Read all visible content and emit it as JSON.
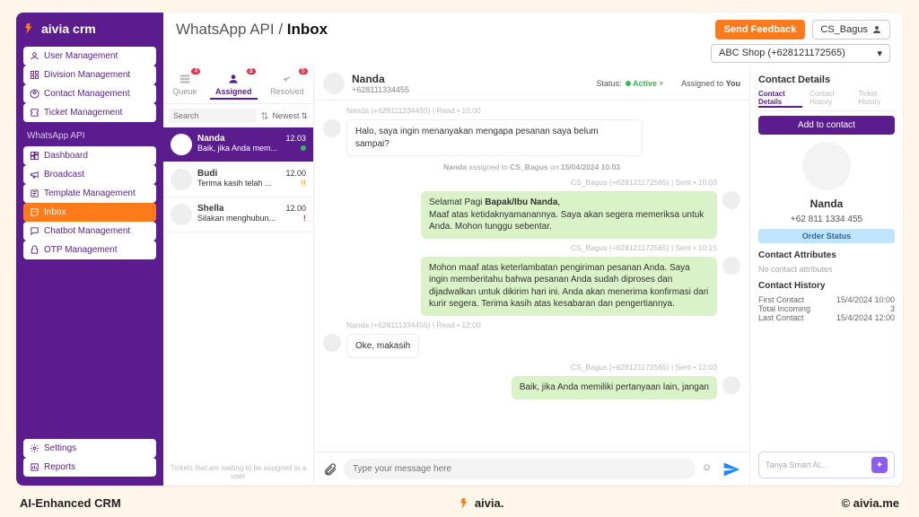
{
  "brand": "aivia crm",
  "nav": {
    "group1": [
      {
        "label": "User Management"
      },
      {
        "label": "Division Management"
      },
      {
        "label": "Contact Management"
      },
      {
        "label": "Ticket Management"
      }
    ],
    "section": "WhatsApp API",
    "group2": [
      {
        "label": "Dashboard"
      },
      {
        "label": "Broadcast"
      },
      {
        "label": "Template Management"
      },
      {
        "label": "Inbox",
        "active": true
      },
      {
        "label": "Chatbot Management"
      },
      {
        "label": "OTP Management"
      }
    ],
    "bottom": [
      {
        "label": "Settings"
      },
      {
        "label": "Reports"
      }
    ]
  },
  "breadcrumb": {
    "parent": "WhatsApp API",
    "current": "Inbox"
  },
  "actions": {
    "feedback": "Send Feedback",
    "user": "CS_Bagus"
  },
  "shop_selector": "ABC Shop (+628121172565)",
  "listtabs": {
    "queue": {
      "label": "Queue",
      "badge": "4"
    },
    "assigned": {
      "label": "Assigned",
      "badge": "3"
    },
    "resolved": {
      "label": "Resolved",
      "badge": "5"
    }
  },
  "filters": {
    "search_ph": "Search",
    "sort": "Newest"
  },
  "conversations": [
    {
      "name": "Nanda",
      "time": "12.03",
      "preview": "Baik, jika Anda mem...",
      "flag": "green",
      "active": true
    },
    {
      "name": "Budi",
      "time": "12.00",
      "preview": "Terima kasih telah ...",
      "flag": "yellow"
    },
    {
      "name": "Shella",
      "time": "12.00",
      "preview": "Silakan menghubun...",
      "flag": "red"
    }
  ],
  "waiting_note": "Tickets that are waiting to be assigned to a user",
  "chat": {
    "name": "Nanda",
    "phone": "+628111334455",
    "status_label": "Status:",
    "status_value": "Active",
    "assigned_label": "Assigned to",
    "assigned_value": "You",
    "divider": "Nanda assigned to CS_Bagus on 15/04/2024 10.03",
    "messages": [
      {
        "dir": "in",
        "meta": "Nanda (+628111334455) | Read • 10:00",
        "text": "Halo, saya ingin menanyakan mengapa pesanan saya belum sampai?"
      },
      {
        "dir": "out",
        "meta": "CS_Bagus (+628121172565) | Sent • 10.03",
        "html": "Selamat Pagi <b>Bapak/Ibu Nanda</b>,<br>Maaf atas ketidaknyamanannya. Saya akan segera memeriksa untuk Anda. Mohon tunggu sebentar."
      },
      {
        "dir": "out",
        "meta": "CS_Bagus (+628121172565) | Sent • 10:15",
        "text": "Mohon maaf atas keterlambatan pengiriman pesanan Anda. Saya ingin memberitahu bahwa pesanan Anda sudah diproses dan dijadwalkan untuk dikirim hari ini. Anda akan menerima konfirmasi dari kurir segera. Terima kasih atas kesabaran dan pengertiannya."
      },
      {
        "dir": "in",
        "meta": "Nanda (+628111334455) | Read • 12:00",
        "text": "Oke, makasih"
      },
      {
        "dir": "out",
        "meta": "CS_Bagus (+628121172565) | Sent • 12:03",
        "text": "Baik, jika Anda memiliki pertanyaan lain, jangan"
      }
    ],
    "composer_ph": "Type your message here"
  },
  "details": {
    "header": "Contact Details",
    "tabs": [
      "Contact Details",
      "Contact History",
      "Ticket History"
    ],
    "add_btn": "Add to contact",
    "name": "Nanda",
    "phone": "+62 811 1334 455",
    "order_status": "Order Status",
    "attrs_title": "Contact Attributes",
    "attrs_empty": "No contact attributes",
    "history_title": "Contact History",
    "history": [
      {
        "k": "First Contact",
        "v": "15/4/2024 10:00"
      },
      {
        "k": "Total Incoming",
        "v": "3"
      },
      {
        "k": "Last Contact",
        "v": "15/4/2024 12:00"
      }
    ],
    "smartai_ph": "Tanya Smart AI..."
  },
  "footer": {
    "left": "AI-Enhanced CRM",
    "mid": "aivia.",
    "right": "© aivia.me"
  }
}
